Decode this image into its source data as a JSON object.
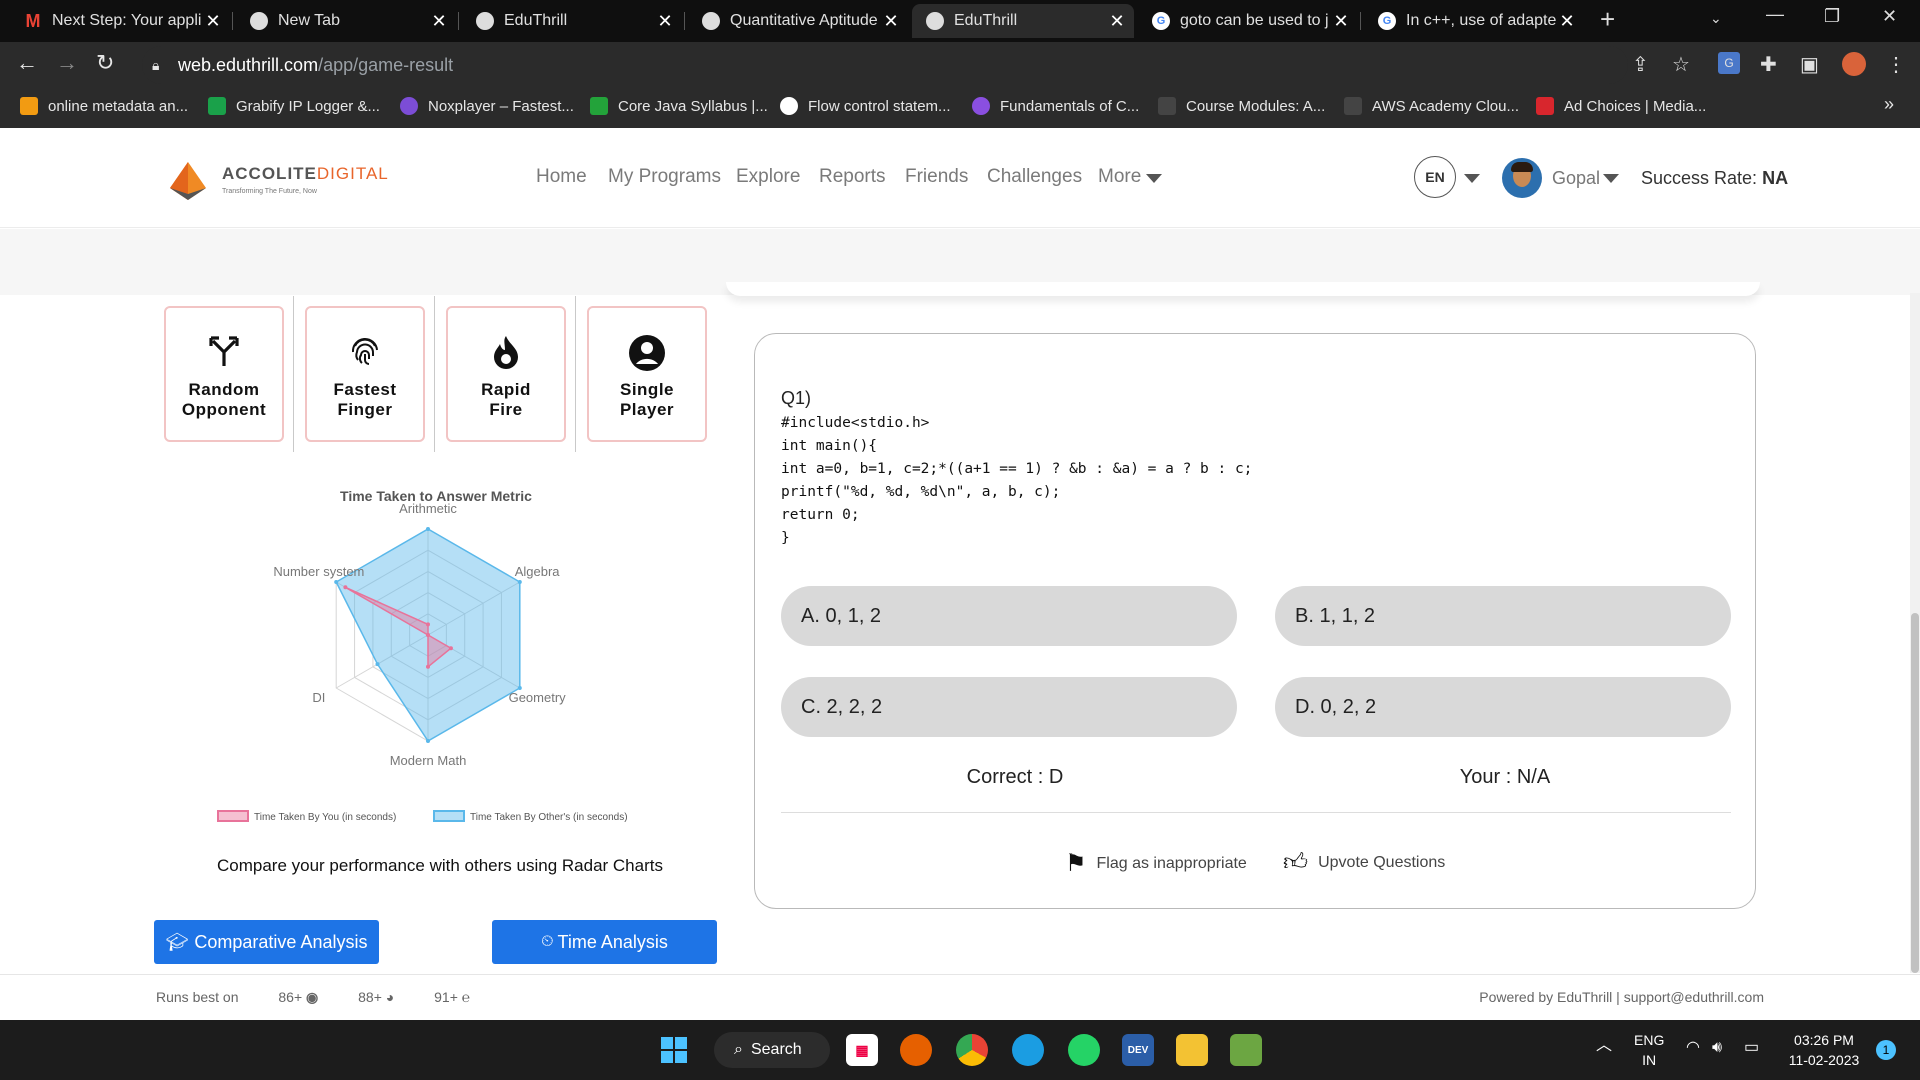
{
  "browser": {
    "tabs": [
      {
        "title": "Next Step: Your applic",
        "icon": "gmail-icon"
      },
      {
        "title": "New Tab",
        "icon": "chrome-icon"
      },
      {
        "title": "EduThrill",
        "icon": "eduthrill-icon"
      },
      {
        "title": "Quantitative Aptitude",
        "icon": "eduthrill-icon"
      },
      {
        "title": "EduThrill",
        "icon": "eduthrill-icon"
      },
      {
        "title": "goto can be used to j",
        "icon": "google-icon"
      },
      {
        "title": "In c++, use of adapte",
        "icon": "google-icon"
      }
    ],
    "url_host": "web.eduthrill.com",
    "url_path": "/app/game-result",
    "bookmarks": [
      "online metadata an...",
      "Grabify IP Logger &...",
      "Noxplayer – Fastest...",
      "Core Java Syllabus |...",
      "Flow control statem...",
      "Fundamentals of C...",
      "Course Modules: A...",
      "AWS Academy Clou...",
      "Ad Choices | Media..."
    ],
    "more_bookmarks": "»"
  },
  "header": {
    "logo_main": "ACCOLITE",
    "logo_accent": "DIGITAL",
    "logo_tagline": "Transforming The Future, Now",
    "nav": [
      "Home",
      "My Programs",
      "Explore",
      "Reports",
      "Friends",
      "Challenges",
      "More"
    ],
    "lang": "EN",
    "user": "Gopal",
    "success_label": "Success Rate:",
    "success_value": "NA"
  },
  "modes": [
    {
      "label1": "Random",
      "label2": "Opponent",
      "icon": "split-arrow-icon"
    },
    {
      "label1": "Fastest",
      "label2": "Finger",
      "icon": "fingerprint-icon"
    },
    {
      "label1": "Rapid",
      "label2": "Fire",
      "icon": "fire-icon"
    },
    {
      "label1": "Single",
      "label2": "Player",
      "icon": "user-circle-icon"
    }
  ],
  "chart_data": {
    "type": "radar",
    "title": "Time Taken to Answer Metric",
    "axes": [
      "Arithmetic",
      "Algebra",
      "Geometry",
      "Modern Math",
      "DI",
      "Number system"
    ],
    "series": [
      {
        "name": "Time Taken By You (in seconds)",
        "color": "#e8739a",
        "values": [
          0.1,
          0.0,
          0.25,
          0.3,
          0.0,
          0.9
        ]
      },
      {
        "name": "Time Taken By Other's (in seconds)",
        "color": "#5ab8ea",
        "values": [
          1.0,
          1.0,
          1.0,
          1.0,
          0.55,
          1.0
        ]
      }
    ],
    "rings": 5
  },
  "compare_text": "Compare your performance with others using Radar Charts",
  "buttons": {
    "comparative": "Comparative Analysis",
    "time": "Time Analysis"
  },
  "question": {
    "number": "Q1)",
    "code": "#include<stdio.h>\nint main(){\nint a=0, b=1, c=2;*((a+1 == 1) ? &b : &a) = a ? b : c;\nprintf(\"%d, %d, %d\\n\", a, b, c);\nreturn 0;\n}",
    "options": [
      "A. 0, 1, 2",
      "B. 1, 1, 2",
      "C. 2, 2, 2",
      "D. 0, 2, 2"
    ],
    "correct": "Correct : D",
    "your": "Your : N/A",
    "flag": "Flag as inappropriate",
    "upvote": "Upvote Questions"
  },
  "footer": {
    "runs_label": "Runs best on",
    "browsers": [
      "86+",
      "88+",
      "91+"
    ],
    "powered": "Powered by EduThrill | support@eduthrill.com"
  },
  "taskbar": {
    "search": "Search",
    "lang1": "ENG",
    "lang2": "IN",
    "time": "03:26 PM",
    "date": "11-02-2023",
    "notif": "1"
  }
}
